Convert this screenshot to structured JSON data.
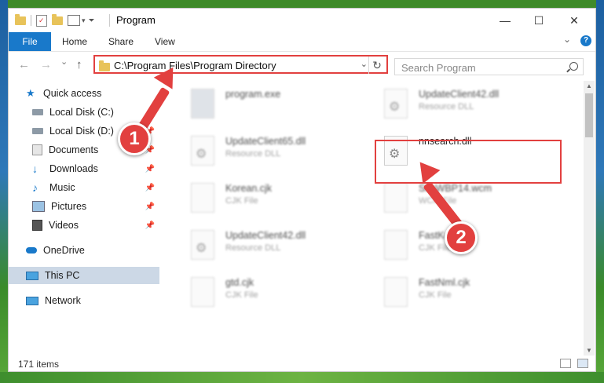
{
  "window": {
    "title": "Program",
    "minimize": "—",
    "maximize": "☐",
    "close": "✕"
  },
  "ribbon": {
    "tabs": [
      "File",
      "Home",
      "Share",
      "View"
    ],
    "help": "?",
    "collapse": "⌄"
  },
  "address_bar": {
    "path": "C:\\Program Files\\Program Directory",
    "dropdown": "⌄",
    "refresh": "↻"
  },
  "search": {
    "placeholder": "Search Program"
  },
  "nav": {
    "back": "←",
    "forward": "→",
    "history": "⌄",
    "up": "↑"
  },
  "sidebar": {
    "items": [
      {
        "label": "Quick access",
        "icon": "star-icon",
        "pinned": false
      },
      {
        "label": "Local Disk (C:)",
        "icon": "drive-icon",
        "pinned": true
      },
      {
        "label": "Local Disk (D:)",
        "icon": "drive-icon",
        "pinned": true
      },
      {
        "label": "Documents",
        "icon": "documents-icon",
        "pinned": true
      },
      {
        "label": "Downloads",
        "icon": "download-icon",
        "pinned": true
      },
      {
        "label": "Music",
        "icon": "music-icon",
        "pinned": true
      },
      {
        "label": "Pictures",
        "icon": "pictures-icon",
        "pinned": true
      },
      {
        "label": "Videos",
        "icon": "videos-icon",
        "pinned": true
      },
      {
        "label": "OneDrive",
        "icon": "cloud-icon",
        "pinned": false
      },
      {
        "label": "This PC",
        "icon": "computer-icon",
        "pinned": false,
        "selected": true
      },
      {
        "label": "Network",
        "icon": "network-icon",
        "pinned": false
      }
    ],
    "pin_glyph": "📌"
  },
  "files": [
    {
      "name": "program.exe",
      "type": "",
      "icon": "exe-icon"
    },
    {
      "name": "UpdateClient42.dll",
      "type": "Resource DLL",
      "icon": "dll-icon"
    },
    {
      "name": "UpdateClient65.dll",
      "type": "Resource DLL",
      "icon": "dll-icon"
    },
    {
      "name": "nnsearch.dll",
      "type": "",
      "icon": "dll-icon"
    },
    {
      "name": "Korean.cjk",
      "type": "CJK File",
      "icon": "file-icon"
    },
    {
      "name": "SimWBP14.wcm",
      "type": "WCM File",
      "icon": "file-icon"
    },
    {
      "name": "UpdateClient42.dll",
      "type": "Resource DLL",
      "icon": "dll-icon"
    },
    {
      "name": "FastKo.cjk",
      "type": "CJK File",
      "icon": "file-icon"
    },
    {
      "name": "gtd.cjk",
      "type": "CJK File",
      "icon": "file-icon"
    },
    {
      "name": "FastNml.cjk",
      "type": "CJK File",
      "icon": "file-icon"
    }
  ],
  "status": {
    "count": "171 items"
  },
  "annotations": {
    "step1": "1",
    "step2": "2",
    "color": "#e2403f"
  }
}
